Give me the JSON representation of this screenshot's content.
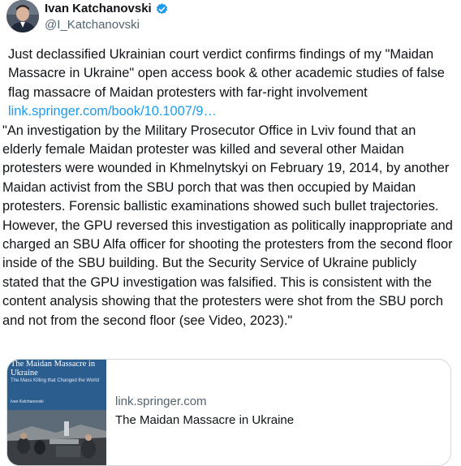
{
  "author": {
    "name": "Ivan Katchanovski",
    "handle": "@I_Katchanovski",
    "verified": true
  },
  "tweet": {
    "intro": "Just declassified Ukrainian court verdict confirms findings of my \"Maidan Massacre in Ukraine\" open access book & other academic studies of false flag massacre of Maidan protesters with far-right involvement",
    "link_text": "link.springer.com/book/10.1007/9…",
    "quote": "\"An investigation by the Military Prosecutor Office in Lviv found that an elderly female Maidan protester was killed and several other Maidan protesters were wounded in Khmelnytskyi on February 19, 2014, by another Maidan activist from the SBU porch that was then occupied by Maidan protesters. Forensic ballistic examinations showed such bullet trajectories. However, the GPU reversed this investigation as politically inappropriate and charged an SBU Alfa officer for shooting the protesters from the second floor inside of the SBU building. But the Security Service of Ukraine publicly stated that the GPU investigation was falsified. This is consistent with the content analysis showing that the protesters were shot from the SBU porch and not from the second floor (see Video, 2023).\""
  },
  "card": {
    "domain": "link.springer.com",
    "title": "The Maidan Massacre in Ukraine",
    "book_cover": {
      "title": "The Maidan Massacre in Ukraine",
      "subtitle": "The Mass Killing that Changed the World",
      "author": "Ivan Katchanovski"
    }
  },
  "colors": {
    "link": "#1d9bf0",
    "verified": "#1d9bf0",
    "muted": "#536471",
    "book_cover": "#2c5d8f"
  },
  "icons": {
    "verified": "verified-badge-icon",
    "avatar": "avatar"
  }
}
